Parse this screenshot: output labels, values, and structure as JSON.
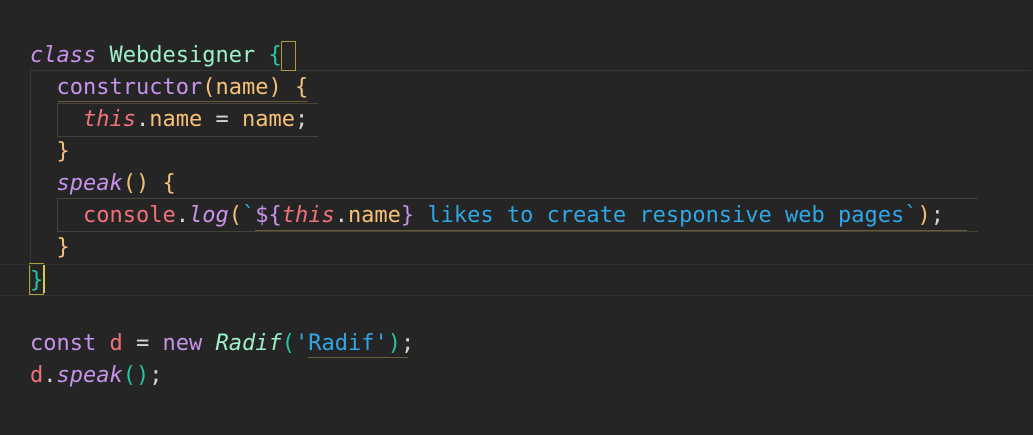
{
  "editor": {
    "lines": [
      {
        "tokens": [
          {
            "t": "class",
            "c": "kw-italic"
          },
          {
            "t": " ",
            "c": "punct"
          },
          {
            "t": "Webdesigner",
            "c": "cls"
          },
          {
            "t": " ",
            "c": "punct"
          },
          {
            "t": "{",
            "c": "brace-g"
          }
        ]
      },
      {
        "tokens": [
          {
            "t": "  ",
            "c": "punct"
          },
          {
            "t": "constructor",
            "c": "fn"
          },
          {
            "t": "(",
            "c": "paren-y"
          },
          {
            "t": "name",
            "c": "param"
          },
          {
            "t": ")",
            "c": "paren-y"
          },
          {
            "t": " ",
            "c": "punct"
          },
          {
            "t": "{",
            "c": "brace-y"
          }
        ]
      },
      {
        "tokens": [
          {
            "t": "    ",
            "c": "punct"
          },
          {
            "t": "this",
            "c": "this"
          },
          {
            "t": ".",
            "c": "punct"
          },
          {
            "t": "name",
            "c": "prop"
          },
          {
            "t": " = ",
            "c": "op"
          },
          {
            "t": "name",
            "c": "param"
          },
          {
            "t": ";",
            "c": "punct"
          }
        ]
      },
      {
        "tokens": [
          {
            "t": "  ",
            "c": "punct"
          },
          {
            "t": "}",
            "c": "brace-y"
          }
        ]
      },
      {
        "tokens": [
          {
            "t": "  ",
            "c": "punct"
          },
          {
            "t": "speak",
            "c": "fn-italic"
          },
          {
            "t": "()",
            "c": "paren-y"
          },
          {
            "t": " ",
            "c": "punct"
          },
          {
            "t": "{",
            "c": "brace-y"
          }
        ]
      },
      {
        "tokens": [
          {
            "t": "    ",
            "c": "punct"
          },
          {
            "t": "console",
            "c": "obj"
          },
          {
            "t": ".",
            "c": "punct"
          },
          {
            "t": "log",
            "c": "log"
          },
          {
            "t": "(",
            "c": "paren-y"
          },
          {
            "t": "`",
            "c": "str"
          },
          {
            "t": "${",
            "c": "kw"
          },
          {
            "t": "this",
            "c": "this"
          },
          {
            "t": ".",
            "c": "punct"
          },
          {
            "t": "name",
            "c": "prop"
          },
          {
            "t": "}",
            "c": "kw"
          },
          {
            "t": " likes to create responsive web pages",
            "c": "str"
          },
          {
            "t": "`",
            "c": "str"
          },
          {
            "t": ")",
            "c": "paren-y"
          },
          {
            "t": ";",
            "c": "punct"
          }
        ]
      },
      {
        "tokens": [
          {
            "t": "  ",
            "c": "punct"
          },
          {
            "t": "}",
            "c": "brace-y"
          }
        ]
      },
      {
        "tokens": [
          {
            "t": "}",
            "c": "brace-g"
          }
        ]
      },
      {
        "tokens": []
      },
      {
        "tokens": [
          {
            "t": "const",
            "c": "kw"
          },
          {
            "t": " ",
            "c": "punct"
          },
          {
            "t": "d",
            "c": "var"
          },
          {
            "t": " = ",
            "c": "op"
          },
          {
            "t": "new",
            "c": "kw"
          },
          {
            "t": " ",
            "c": "punct"
          },
          {
            "t": "Radif",
            "c": "classref"
          },
          {
            "t": "(",
            "c": "paren-g"
          },
          {
            "t": "'Radif'",
            "c": "str"
          },
          {
            "t": ")",
            "c": "paren-g"
          },
          {
            "t": ";",
            "c": "punct"
          }
        ]
      },
      {
        "tokens": [
          {
            "t": "d",
            "c": "var"
          },
          {
            "t": ".",
            "c": "punct"
          },
          {
            "t": "speak",
            "c": "fn-italic"
          },
          {
            "t": "()",
            "c": "paren-g"
          },
          {
            "t": ";",
            "c": "punct"
          }
        ]
      }
    ],
    "current_line": 7
  }
}
